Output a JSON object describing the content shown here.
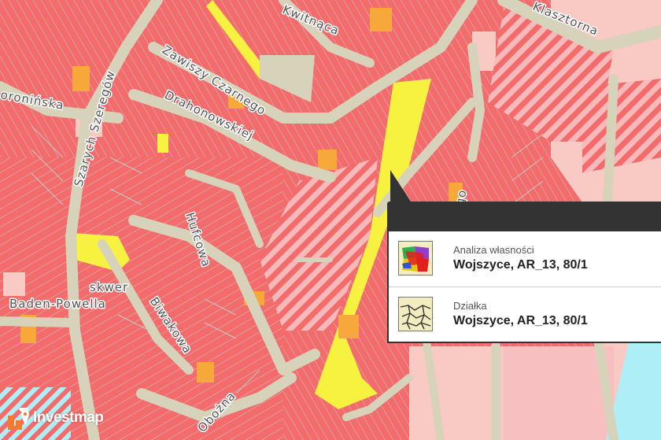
{
  "map": {
    "streets": [
      "Kwitnąca",
      "Klasztorna",
      "Zawiszy Czarnego",
      "Drahonowskiej",
      "Szarych Szeregów",
      "oronińska",
      "Hufcowa",
      "Biwakowa",
      "Obożna",
      "go"
    ],
    "places": [
      "skwer",
      "Baden-Powella"
    ]
  },
  "popup": {
    "items": [
      {
        "kind": "Analiza własności",
        "value": "Wojszyce, AR_13, 80/1",
        "icon": "ownership-analysis-icon"
      },
      {
        "kind": "Działka",
        "value": "Wojszyce, AR_13, 80/1",
        "icon": "parcel-icon"
      }
    ]
  },
  "logo": {
    "text": "Investmap"
  },
  "colors": {
    "residential": "#f36b6b",
    "light": "#f9c9c4",
    "road": "#d7d2ba",
    "yellow": "#f6f23f",
    "orange": "#f6a93a",
    "water": "#aeeff7",
    "popup_dark": "#333333",
    "logo_orange": "#f47a2c"
  }
}
